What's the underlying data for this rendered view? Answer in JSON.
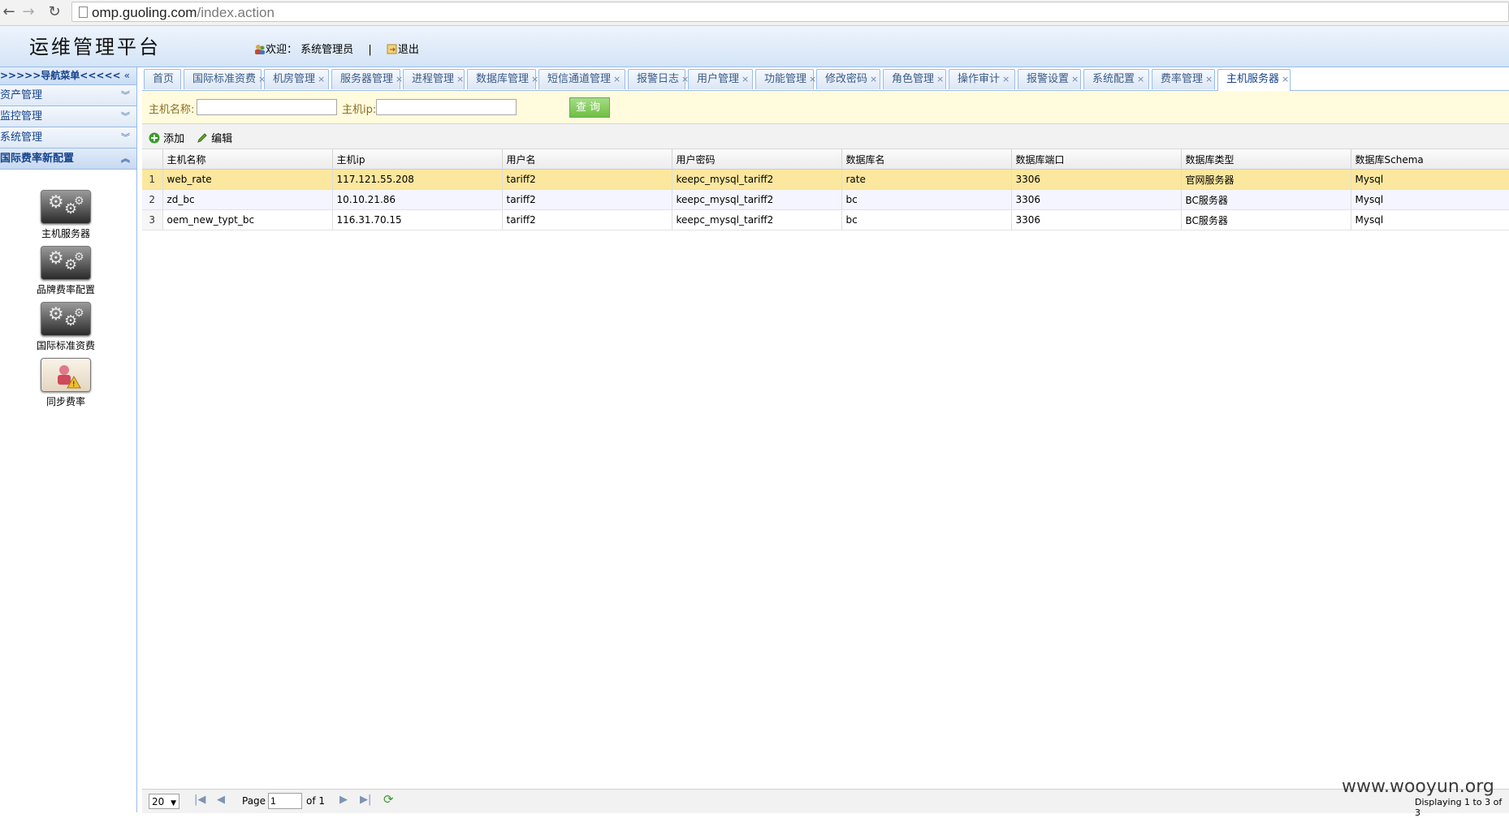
{
  "browser": {
    "url_domain": "omp.guoling.com",
    "url_path": "/index.action"
  },
  "header": {
    "title": "运维管理平台",
    "welcome": "欢迎：",
    "user": "系统管理员",
    "separator": "|",
    "logout": "退出"
  },
  "sidebar": {
    "nav_title": ">>>>>导航菜单<<<<<",
    "collapse_glyph": "«",
    "sections": [
      {
        "label": "资产管理",
        "glyph": "⌄"
      },
      {
        "label": "监控管理",
        "glyph": "⌄"
      },
      {
        "label": "系统管理",
        "glyph": "⌄"
      },
      {
        "label": "国际费率新配置",
        "glyph": "⌃"
      }
    ],
    "icons": [
      {
        "label": "主机服务器",
        "icon": "gears-icon"
      },
      {
        "label": "品牌费率配置",
        "icon": "gears-icon"
      },
      {
        "label": "国际标准资费",
        "icon": "gears-icon"
      },
      {
        "label": "同步费率",
        "icon": "sync-icon"
      }
    ]
  },
  "tabs": [
    {
      "label": "首页",
      "closable": false
    },
    {
      "label": "国际标准资费",
      "closable": true
    },
    {
      "label": "机房管理",
      "closable": true
    },
    {
      "label": "服务器管理",
      "closable": true
    },
    {
      "label": "进程管理",
      "closable": true
    },
    {
      "label": "数据库管理",
      "closable": true
    },
    {
      "label": "短信通道管理",
      "closable": true
    },
    {
      "label": "报警日志",
      "closable": true
    },
    {
      "label": "用户管理",
      "closable": true
    },
    {
      "label": "功能管理",
      "closable": true
    },
    {
      "label": "修改密码",
      "closable": true
    },
    {
      "label": "角色管理",
      "closable": true
    },
    {
      "label": "操作审计",
      "closable": true
    },
    {
      "label": "报警设置",
      "closable": true
    },
    {
      "label": "系统配置",
      "closable": true
    },
    {
      "label": "费率管理",
      "closable": true
    },
    {
      "label": "主机服务器",
      "closable": true,
      "active": true
    }
  ],
  "tab_close_glyph": "×",
  "search": {
    "host_name_label": "主机名称:",
    "host_name_value": "",
    "host_ip_label": "主机ip:",
    "host_ip_value": "",
    "query_button": "查询"
  },
  "toolbar": {
    "add_label": "添加",
    "edit_label": "编辑"
  },
  "grid": {
    "columns": [
      "主机名称",
      "主机ip",
      "用户名",
      "用户密码",
      "数据库名",
      "数据库端口",
      "数据库类型",
      "数据库Schema"
    ],
    "rows": [
      {
        "n": "1",
        "cells": [
          "web_rate",
          "117.121.55.208",
          "tariff2",
          "keepc_mysql_tariff2",
          "rate",
          "3306",
          "官网服务器",
          "Mysql"
        ]
      },
      {
        "n": "2",
        "cells": [
          "zd_bc",
          "10.10.21.86",
          "tariff2",
          "keepc_mysql_tariff2",
          "bc",
          "3306",
          "BC服务器",
          "Mysql"
        ]
      },
      {
        "n": "3",
        "cells": [
          "oem_new_typt_bc",
          "116.31.70.15",
          "tariff2",
          "keepc_mysql_tariff2",
          "bc",
          "3306",
          "BC服务器",
          "Mysql"
        ]
      }
    ],
    "selected_row": 1
  },
  "pager": {
    "page_size": "20",
    "page_label": "Page",
    "page_value": "1",
    "of_label": "of 1",
    "displaying": "Displaying 1 to 3 of 3"
  },
  "watermark": "www.wooyun.org",
  "colors": {
    "accent": "#99bbe8",
    "selected_row": "#fbe79e",
    "search_bg": "#fffbdc",
    "query_button": "#6fbf45"
  }
}
